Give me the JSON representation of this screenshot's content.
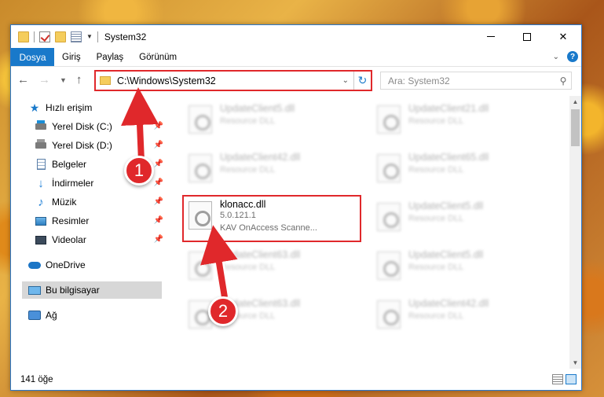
{
  "window": {
    "title": "System32",
    "caption_min": "",
    "caption_max": "",
    "caption_close": "✕"
  },
  "ribbon": {
    "file_tab": "Dosya",
    "tabs": [
      "Giriş",
      "Paylaş",
      "Görünüm"
    ]
  },
  "address": {
    "path": "C:\\Windows\\System32",
    "search_placeholder": "Ara: System32"
  },
  "nav_pane": {
    "quick_access": "Hızlı erişim",
    "items": [
      {
        "label": "Yerel Disk (C:)",
        "icon": "disk-icon",
        "pinned": true
      },
      {
        "label": "Yerel Disk (D:)",
        "icon": "disk-icon",
        "pinned": true
      },
      {
        "label": "Belgeler",
        "icon": "documents-icon",
        "pinned": true
      },
      {
        "label": "İndirmeler",
        "icon": "download-icon",
        "pinned": true
      },
      {
        "label": "Müzik",
        "icon": "music-icon",
        "pinned": true
      },
      {
        "label": "Resimler",
        "icon": "pictures-icon",
        "pinned": true
      },
      {
        "label": "Videolar",
        "icon": "videos-icon",
        "pinned": true
      }
    ],
    "onedrive": "OneDrive",
    "this_pc": "Bu bilgisayar",
    "network": "Ağ"
  },
  "files": [
    {
      "name": "UpdateClient5.dll",
      "desc": "Resource DLL"
    },
    {
      "name": "UpdateClient21.dll",
      "desc": "Resource DLL"
    },
    {
      "name": "UpdateClient42.dll",
      "desc": "Resource DLL"
    },
    {
      "name": "UpdateClient65.dll",
      "desc": "Resource DLL"
    },
    {
      "name": "klonacc.dll",
      "version": "5.0.121.1",
      "desc": "KAV OnAccess Scanne..."
    },
    {
      "name": "UpdateClient5.dll",
      "desc": "Resource DLL"
    },
    {
      "name": "UpdateClient63.dll",
      "desc": "Resource DLL"
    },
    {
      "name": "UpdateClient5.dll",
      "desc": "Resource DLL"
    },
    {
      "name": "UpdateClient63.dll",
      "desc": "Resource DLL"
    },
    {
      "name": "UpdateClient42.dll",
      "desc": "Resource DLL"
    }
  ],
  "status": {
    "item_count": "141 öğe"
  },
  "annotations": {
    "step1": "1",
    "step2": "2",
    "color": "#e0282b"
  }
}
